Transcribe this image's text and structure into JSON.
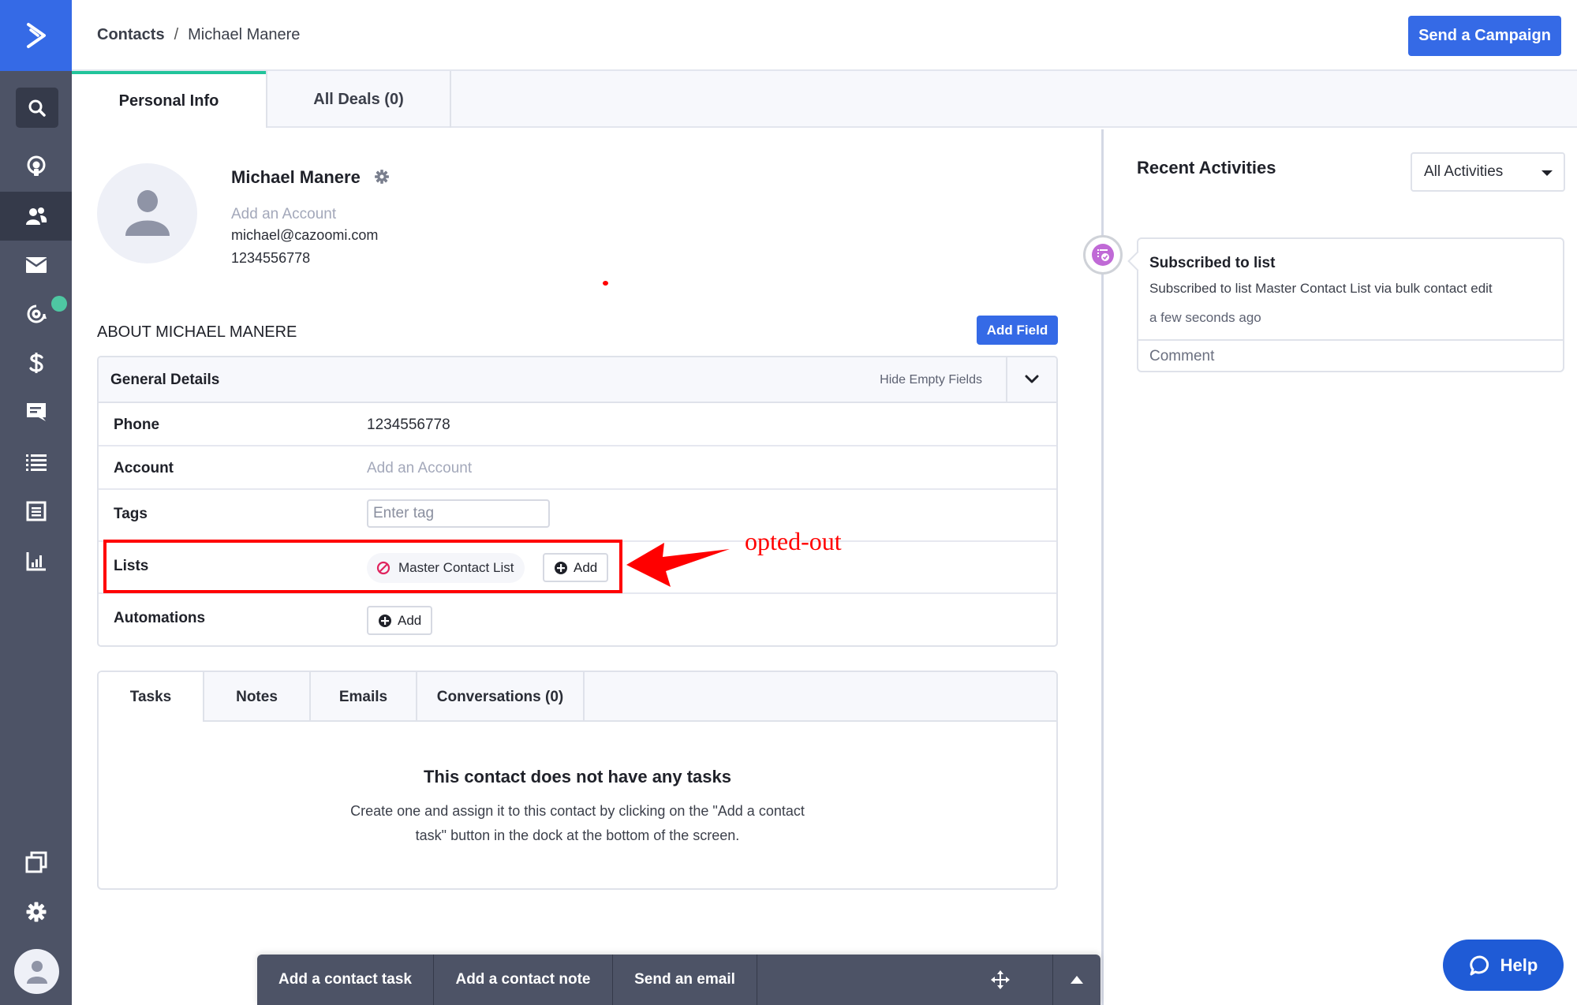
{
  "sidebar": {
    "items": [
      {
        "name": "search",
        "icon": "search-icon"
      },
      {
        "name": "contacts-overview",
        "icon": "location-pin-icon"
      },
      {
        "name": "contacts",
        "icon": "contacts-icon",
        "active": true
      },
      {
        "name": "campaigns",
        "icon": "envelope-icon"
      },
      {
        "name": "automations",
        "icon": "automation-gear-icon",
        "badge": "notification-dot"
      },
      {
        "name": "deals",
        "icon": "dollar-icon"
      },
      {
        "name": "conversations",
        "icon": "chat-icon"
      },
      {
        "name": "lists",
        "icon": "list-icon"
      },
      {
        "name": "forms",
        "icon": "form-icon"
      },
      {
        "name": "reports",
        "icon": "bar-chart-icon"
      },
      {
        "name": "apps",
        "icon": "windows-icon"
      },
      {
        "name": "settings",
        "icon": "gear-icon"
      },
      {
        "name": "profile",
        "icon": "user-avatar-icon"
      }
    ],
    "badge_color": "#4ec7a2"
  },
  "header": {
    "breadcrumb_root": "Contacts",
    "breadcrumb_separator": "/",
    "breadcrumb_current": "Michael Manere",
    "send_campaign_label": "Send a Campaign"
  },
  "tabs": [
    {
      "label": "Personal Info",
      "active": true
    },
    {
      "label": "All Deals (0)",
      "active": false
    }
  ],
  "contact": {
    "name": "Michael Manere",
    "account_placeholder": "Add an Account",
    "email": "michael@cazoomi.com",
    "phone": "1234556778"
  },
  "about": {
    "heading": "ABOUT MICHAEL MANERE",
    "add_field_label": "Add Field",
    "section_title": "General Details",
    "hide_empty_label": "Hide Empty Fields",
    "fields": {
      "phone": {
        "label": "Phone",
        "value": "1234556778"
      },
      "account": {
        "label": "Account",
        "value": "Add an Account"
      },
      "tags": {
        "label": "Tags",
        "placeholder": "Enter tag"
      },
      "lists": {
        "label": "Lists",
        "chip": "Master Contact List",
        "chip_status": "opted-out",
        "add_label": "Add"
      },
      "automations": {
        "label": "Automations",
        "add_label": "Add"
      }
    }
  },
  "annotation": {
    "text": "opted-out",
    "color": "#ff0000"
  },
  "tasks_panel": {
    "tabs": [
      "Tasks",
      "Notes",
      "Emails",
      "Conversations (0)"
    ],
    "active_tab": "Tasks",
    "empty_title": "This contact does not have any tasks",
    "empty_body": "Create one and assign it to this contact by clicking on the \"Add a contact task\" button in the dock at the bottom of the screen."
  },
  "recent_activities": {
    "title": "Recent Activities",
    "filter_value": "All Activities",
    "items": [
      {
        "title": "Subscribed to list",
        "description": "Subscribed to list Master Contact List via bulk contact edit",
        "time": "a few seconds ago",
        "comment_placeholder": "Comment"
      }
    ]
  },
  "dock": {
    "buttons": [
      "Add a contact task",
      "Add a contact note",
      "Send an email"
    ]
  },
  "help": {
    "label": "Help"
  },
  "colors": {
    "primary": "#356ae6",
    "sidebar": "#4d5366",
    "accent_tab": "#22c49b",
    "optout": "#e0245e",
    "activity_icon": "#c06ad6"
  }
}
